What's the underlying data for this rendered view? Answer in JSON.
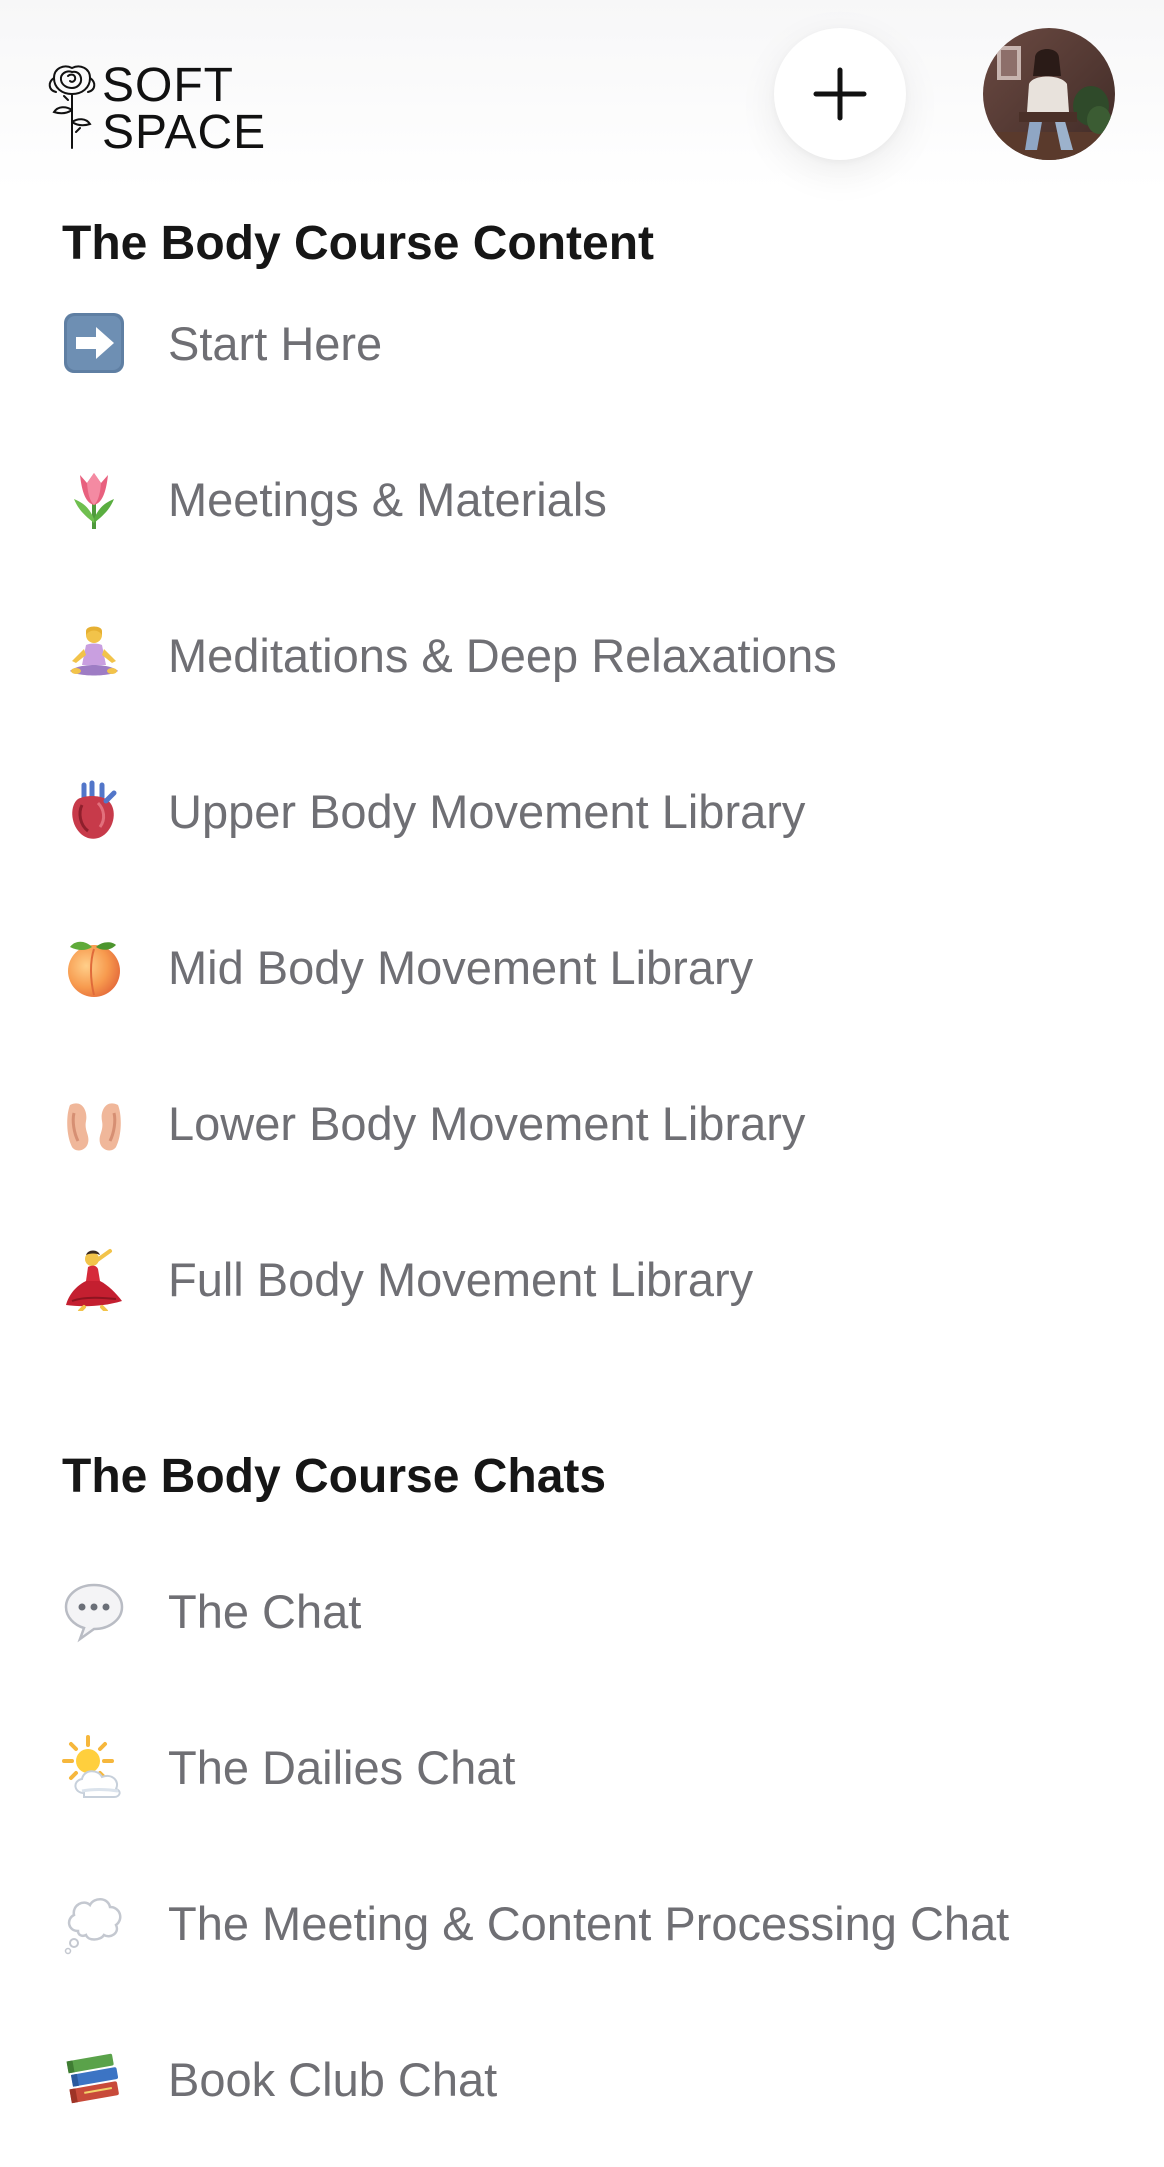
{
  "header": {
    "logo_line1": "SOFT",
    "logo_line2": "SPACE",
    "add_button_label": "+",
    "avatar_alt": "Profile photo"
  },
  "content_section": {
    "title": "The Body Course Content",
    "items": [
      {
        "label": "Start Here",
        "icon": "right-arrow-icon"
      },
      {
        "label": "Meetings & Materials",
        "icon": "tulip-icon"
      },
      {
        "label": "Meditations & Deep Relaxations",
        "icon": "lotus-position-icon"
      },
      {
        "label": "Upper Body Movement Library",
        "icon": "anatomical-heart-icon"
      },
      {
        "label": "Mid Body Movement Library",
        "icon": "peach-icon"
      },
      {
        "label": "Lower Body Movement Library",
        "icon": "ears-icon"
      },
      {
        "label": "Full Body Movement Library",
        "icon": "dancer-icon"
      }
    ]
  },
  "chats_section": {
    "title": "The Body Course Chats",
    "items": [
      {
        "label": "The Chat",
        "icon": "speech-bubble-icon"
      },
      {
        "label": "The Dailies Chat",
        "icon": "sun-behind-cloud-icon"
      },
      {
        "label": "The Meeting & Content Processing Chat",
        "icon": "thought-bubble-icon"
      },
      {
        "label": "Book Club Chat",
        "icon": "books-icon"
      }
    ]
  },
  "colors": {
    "heading": "#161616",
    "item_text": "#6f6f74",
    "background": "#ffffff"
  }
}
